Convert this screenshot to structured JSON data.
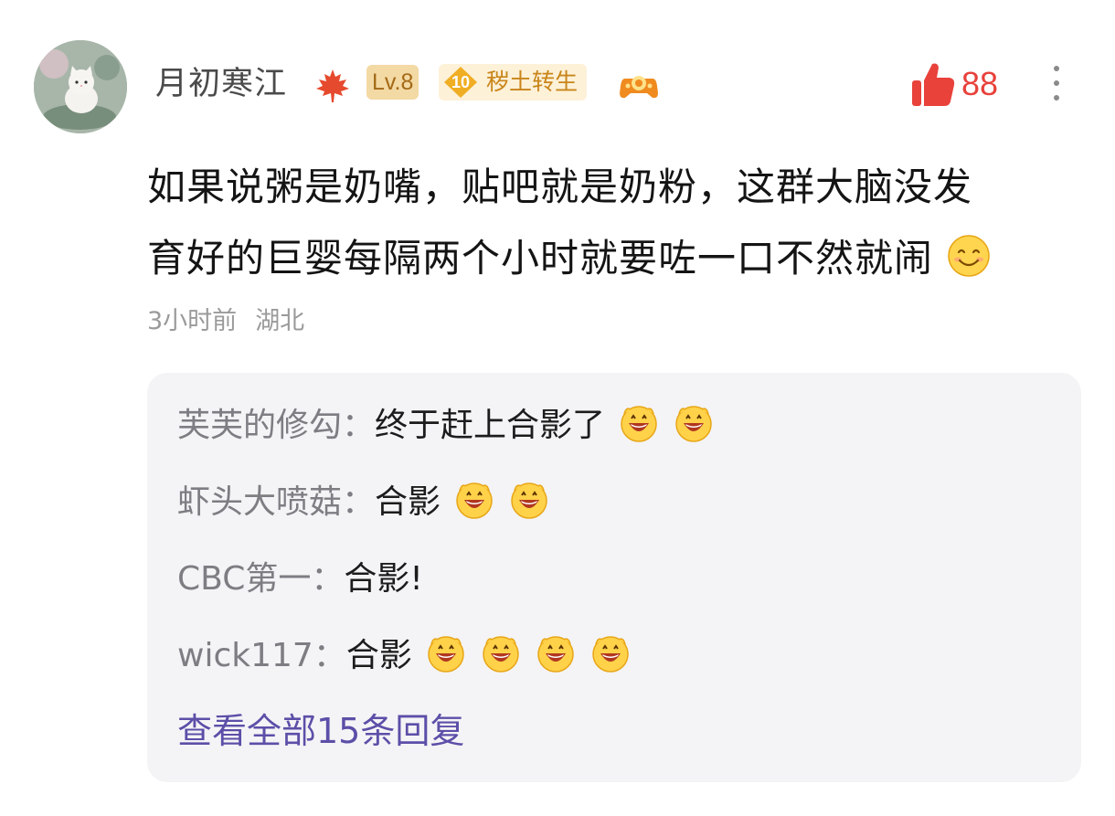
{
  "comment": {
    "username": "月初寒江",
    "level": "Lv.8",
    "title_badge": {
      "number": "10",
      "label": "秽土转生"
    },
    "likes": "88",
    "content_lines": [
      "如果说粥是奶嘴，贴吧就是奶粉，这群大脑没发",
      "育好的巨婴每隔两个小时就要咗一口不然就闹"
    ],
    "time": "3小时前",
    "location": "湖北",
    "icons": {
      "avatar": "cat-avatar",
      "level_flair": "maple-leaf-icon",
      "game": "game-controller-icon",
      "like": "thumbs-up-icon",
      "more": "more-vertical-icon",
      "content_emoji": "smile-emoji"
    }
  },
  "replies": {
    "items": [
      {
        "user": "芙芙的修勾",
        "sep": "：",
        "text": "终于赶上合影了",
        "emoji_count": 2
      },
      {
        "user": "虾头大喷菇",
        "sep": "：",
        "text": "合影",
        "emoji_count": 2
      },
      {
        "user": "CBC第一",
        "sep": "：",
        "text": "合影!",
        "emoji_count": 0
      },
      {
        "user": "wick117",
        "sep": "：",
        "text": "合影",
        "emoji_count": 4
      }
    ],
    "view_all": "查看全部15条回复",
    "emoji": "grinning-emoji"
  },
  "colors": {
    "like": "#e8423b",
    "view_all": "#5b4fa8",
    "reply_user": "#7d7d83",
    "meta": "#9a9a9a",
    "reply_bg": "#f4f4f6"
  }
}
